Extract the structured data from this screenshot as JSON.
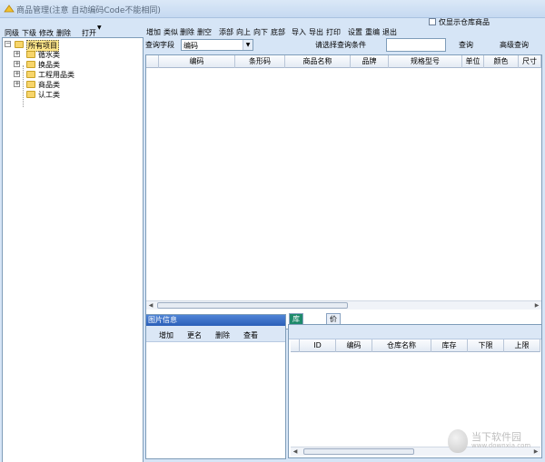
{
  "window": {
    "title": "商品管理(注意 自动编码Code不能相同)"
  },
  "left_toolbar": {
    "items": [
      "同级",
      "下级",
      "修改",
      "删除"
    ],
    "open_label": "打开"
  },
  "tree": {
    "root": "所有项目",
    "children": [
      "循水类",
      "换品类",
      "工程用品类",
      "商品类",
      "认工类"
    ]
  },
  "main_toolbar": {
    "items": [
      "增加",
      "类似",
      "删除",
      "删空",
      "添部",
      "向上",
      "向下",
      "底部",
      "导入",
      "导出",
      "打印",
      "设置",
      "重编",
      "退出"
    ],
    "only_warehouse_label": "仅显示仓库商品",
    "only_warehouse_checked": false
  },
  "query": {
    "field_label": "查询字段",
    "field_value": "编码",
    "hint": "请选择查询条件",
    "input_value": "",
    "search_label": "查询",
    "advanced_label": "高级查询"
  },
  "grid": {
    "columns": [
      "编码",
      "条形码",
      "商品名称",
      "品牌",
      "规格型号",
      "单位",
      "颜色",
      "尺寸"
    ]
  },
  "image_panel": {
    "title": "图片信息",
    "buttons": [
      "增加",
      "更名",
      "删除",
      "查看"
    ]
  },
  "tabs": {
    "items": [
      "库存信息",
      "价格信息"
    ],
    "active": 0
  },
  "stock_grid": {
    "columns": [
      "ID",
      "编码",
      "仓库名称",
      "库存",
      "下限",
      "上限"
    ]
  },
  "watermark": {
    "text": "当下软件园",
    "url": "www.downxia.com"
  }
}
